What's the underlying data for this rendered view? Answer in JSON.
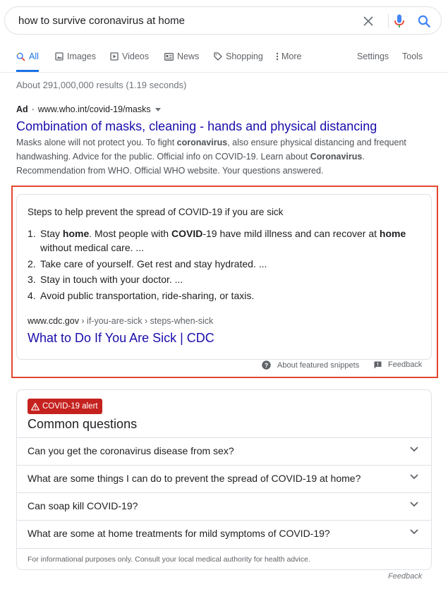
{
  "search": {
    "query": "how to survive coronavirus at home"
  },
  "tabs": [
    {
      "label": "All",
      "icon": "search-icon"
    },
    {
      "label": "Images",
      "icon": "image-icon"
    },
    {
      "label": "Videos",
      "icon": "video-icon"
    },
    {
      "label": "News",
      "icon": "news-icon"
    },
    {
      "label": "Shopping",
      "icon": "tag-icon"
    },
    {
      "label": "More",
      "icon": "more-vert-icon"
    }
  ],
  "tools": {
    "settings": "Settings",
    "tools": "Tools"
  },
  "stats": "About 291,000,000 results (1.19 seconds)",
  "ad": {
    "badge": "Ad",
    "separator": "·",
    "url": "www.who.int/covid-19/masks",
    "title": "Combination of masks, cleaning - hands and physical distancing",
    "desc": {
      "p1": "Masks alone will not protect you. To fight ",
      "b1": "coronavirus",
      "p2": ", also ensure physical distancing and frequent handwashing. Advice for the public. Official info on COVID-19. Learn about ",
      "b2": "Coronavirus",
      "p3": ". Recommendation from WHO. Official WHO website. Your questions answered."
    }
  },
  "snippet": {
    "heading": "Steps to help prevent the spread of COVID-19 if you are sick",
    "items": [
      {
        "num": "1.",
        "pre": "Stay ",
        "b1": "home",
        "mid1": ". Most people with ",
        "b2": "COVID",
        "mid2": "-19 have mild illness and can recover at ",
        "b3": "home",
        "post": " without medical care. ..."
      },
      {
        "num": "2.",
        "text": "Take care of yourself. Get rest and stay hydrated. ..."
      },
      {
        "num": "3.",
        "text": "Stay in touch with your doctor. ..."
      },
      {
        "num": "4.",
        "text": "Avoid public transportation, ride-sharing, or taxis."
      }
    ],
    "cite_domain": "www.cdc.gov",
    "cite_path": " › if-you-are-sick › steps-when-sick",
    "link": "What to Do If You Are Sick | CDC",
    "about": "About featured snippets",
    "feedback": "Feedback"
  },
  "questions": {
    "badge": "COVID-19 alert",
    "title": "Common questions",
    "items": [
      "Can you get the coronavirus disease from sex?",
      "What are some things I can do to prevent the spread of COVID-19 at home?",
      "Can soap kill COVID-19?",
      "What are some at home treatments for mild symptoms of COVID-19?"
    ],
    "note": "For informational purposes only. Consult your local medical authority for health advice."
  },
  "bottom_feedback": "Feedback",
  "colors": {
    "link": "#1a0dab",
    "accent": "#1a73e8",
    "alert": "#c5221f",
    "highlight": "#e3472f"
  }
}
